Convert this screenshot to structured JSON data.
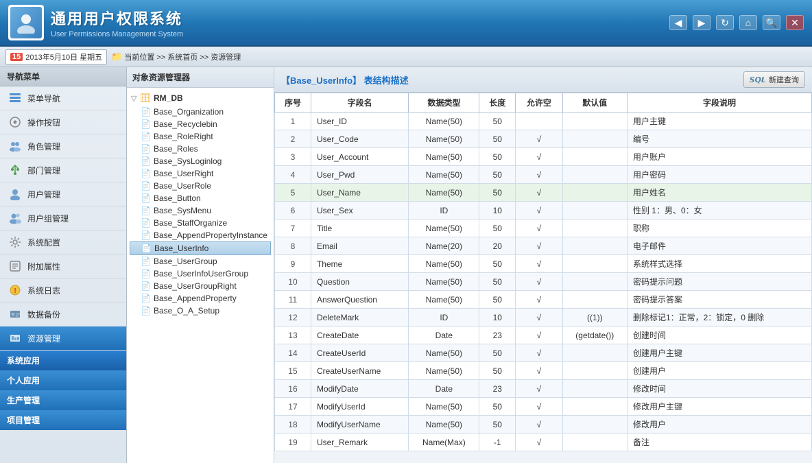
{
  "header": {
    "title": "通用用户权限系统",
    "subtitle": "User Permissions Management System",
    "avatar_char": "👤"
  },
  "toolbar": {
    "date_num": "15",
    "date_text": "2013年5月10日 星期五",
    "location_label": "当前位置",
    "breadcrumb": ">> 系统首页 >> 资源管理",
    "nav_buttons": [
      "◀",
      "▶",
      "↻",
      "🏠",
      "🔍"
    ]
  },
  "sidebar": {
    "header": "导航菜单",
    "items": [
      {
        "id": "menu-nav",
        "label": "菜单导航",
        "icon": "🗂"
      },
      {
        "id": "op-btn",
        "label": "操作按钮",
        "icon": "⚙"
      },
      {
        "id": "role-mgmt",
        "label": "角色管理",
        "icon": "👥"
      },
      {
        "id": "dept-mgmt",
        "label": "部门管理",
        "icon": "🌿"
      },
      {
        "id": "user-mgmt",
        "label": "用户管理",
        "icon": "👤"
      },
      {
        "id": "group-mgmt",
        "label": "用户组管理",
        "icon": "👥"
      },
      {
        "id": "sys-config",
        "label": "系统配置",
        "icon": "🔧"
      },
      {
        "id": "attr",
        "label": "附加属性",
        "icon": "📋"
      },
      {
        "id": "sys-log",
        "label": "系统日志",
        "icon": "⚠"
      },
      {
        "id": "data-backup",
        "label": "数据备份",
        "icon": "💾"
      },
      {
        "id": "res-mgmt",
        "label": "资源管理",
        "icon": "📊",
        "active": true
      }
    ],
    "sections": [
      {
        "id": "sys-app",
        "label": "系统应用"
      },
      {
        "id": "personal-app",
        "label": "个人应用"
      },
      {
        "id": "prod-mgmt",
        "label": "生产管理"
      },
      {
        "id": "proj-mgmt",
        "label": "项目管理"
      }
    ]
  },
  "tree_panel": {
    "header": "对象资源管理器",
    "root": "RM_DB",
    "items": [
      "Base_Organization",
      "Base_Recyclebin",
      "Base_RoleRight",
      "Base_Roles",
      "Base_SysLoginlog",
      "Base_UserRight",
      "Base_UserRole",
      "Base_Button",
      "Base_SysMenu",
      "Base_StaffOrganize",
      "Base_AppendPropertyInstance",
      "Base_UserInfo",
      "Base_UserGroup",
      "Base_UserInfoUserGroup",
      "Base_UserGroupRight",
      "Base_AppendProperty",
      "Base_O_A_Setup"
    ],
    "selected": "Base_UserInfo"
  },
  "table_panel": {
    "title_prefix": "【Base_UserInfo】",
    "title_suffix": "表结构描述",
    "new_query_btn": "新建查询",
    "columns": [
      "序号",
      "字段名",
      "数据类型",
      "长度",
      "允许空",
      "默认值",
      "字段说明"
    ],
    "rows": [
      {
        "seq": 1,
        "field": "User_ID",
        "type": "Name(50)",
        "len": "50",
        "nullable": "",
        "default": "",
        "desc": "用户主键"
      },
      {
        "seq": 2,
        "field": "User_Code",
        "type": "Name(50)",
        "len": "50",
        "nullable": "√",
        "default": "",
        "desc": "编号"
      },
      {
        "seq": 3,
        "field": "User_Account",
        "type": "Name(50)",
        "len": "50",
        "nullable": "√",
        "default": "",
        "desc": "用户账户"
      },
      {
        "seq": 4,
        "field": "User_Pwd",
        "type": "Name(50)",
        "len": "50",
        "nullable": "√",
        "default": "",
        "desc": "用户密码"
      },
      {
        "seq": 5,
        "field": "User_Name",
        "type": "Name(50)",
        "len": "50",
        "nullable": "√",
        "default": "",
        "desc": "用户姓名",
        "highlighted": true
      },
      {
        "seq": 6,
        "field": "User_Sex",
        "type": "ID",
        "len": "10",
        "nullable": "√",
        "default": "",
        "desc": "性别 1：男、0：女"
      },
      {
        "seq": 7,
        "field": "Title",
        "type": "Name(50)",
        "len": "50",
        "nullable": "√",
        "default": "",
        "desc": "职称"
      },
      {
        "seq": 8,
        "field": "Email",
        "type": "Name(20)",
        "len": "20",
        "nullable": "√",
        "default": "",
        "desc": "电子邮件"
      },
      {
        "seq": 9,
        "field": "Theme",
        "type": "Name(50)",
        "len": "50",
        "nullable": "√",
        "default": "",
        "desc": "系统样式选择"
      },
      {
        "seq": 10,
        "field": "Question",
        "type": "Name(50)",
        "len": "50",
        "nullable": "√",
        "default": "",
        "desc": "密码提示问题"
      },
      {
        "seq": 11,
        "field": "AnswerQuestion",
        "type": "Name(50)",
        "len": "50",
        "nullable": "√",
        "default": "",
        "desc": "密码提示答案"
      },
      {
        "seq": 12,
        "field": "DeleteMark",
        "type": "ID",
        "len": "10",
        "nullable": "√",
        "default": "((1))",
        "desc": "删除标记1：正常，2：锁定，0 删除"
      },
      {
        "seq": 13,
        "field": "CreateDate",
        "type": "Date",
        "len": "23",
        "nullable": "√",
        "default": "(getdate())",
        "desc": "创建时间"
      },
      {
        "seq": 14,
        "field": "CreateUserId",
        "type": "Name(50)",
        "len": "50",
        "nullable": "√",
        "default": "",
        "desc": "创建用户主键"
      },
      {
        "seq": 15,
        "field": "CreateUserName",
        "type": "Name(50)",
        "len": "50",
        "nullable": "√",
        "default": "",
        "desc": "创建用户"
      },
      {
        "seq": 16,
        "field": "ModifyDate",
        "type": "Date",
        "len": "23",
        "nullable": "√",
        "default": "",
        "desc": "修改时间"
      },
      {
        "seq": 17,
        "field": "ModifyUserId",
        "type": "Name(50)",
        "len": "50",
        "nullable": "√",
        "default": "",
        "desc": "修改用户主键"
      },
      {
        "seq": 18,
        "field": "ModifyUserName",
        "type": "Name(50)",
        "len": "50",
        "nullable": "√",
        "default": "",
        "desc": "修改用户"
      },
      {
        "seq": 19,
        "field": "User_Remark",
        "type": "Name(Max)",
        "len": "-1",
        "nullable": "√",
        "default": "",
        "desc": "备注"
      }
    ]
  }
}
